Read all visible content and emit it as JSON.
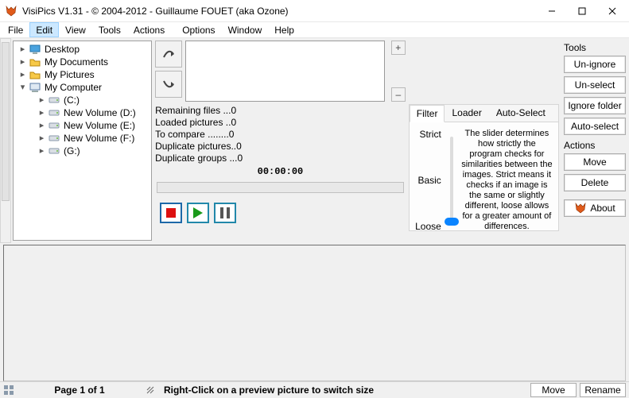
{
  "title": "VisiPics V1.31 - © 2004-2012 - Guillaume FOUET (aka Ozone)",
  "menu": {
    "file": "File",
    "edit": "Edit",
    "view": "View",
    "tools": "Tools",
    "actions": "Actions",
    "options": "Options",
    "window": "Window",
    "help": "Help"
  },
  "tree": {
    "desktop": "Desktop",
    "mydocs": "My Documents",
    "mypics": "My Pictures",
    "mycomp": "My Computer",
    "drives": {
      "c": "(C:)",
      "d": "New Volume (D:)",
      "e": "New Volume (E:)",
      "f": "New Volume (F:)",
      "g": "(G:)"
    }
  },
  "stats": {
    "remaining": "Remaining files ...0",
    "loaded": "Loaded pictures ..0",
    "compare": "To compare ........0",
    "duppics": "Duplicate pictures..0",
    "dupgroups": "Duplicate groups ...0",
    "timer": "00:00:00"
  },
  "tabs": {
    "filter": "Filter",
    "loader": "Loader",
    "autoselect": "Auto-Select"
  },
  "slider": {
    "strict": "Strict",
    "basic": "Basic",
    "loose": "Loose"
  },
  "help": "The slider determines how strictly the program checks for similarities between the images. Strict means it checks if an image is the same or slightly different, loose allows for a greater amount of differences.",
  "tools": {
    "header": "Tools",
    "unignore": "Un-ignore",
    "unselect": "Un-select",
    "ignorefolder": "Ignore folder",
    "autoselect": "Auto-select"
  },
  "actions": {
    "header": "Actions",
    "move": "Move",
    "delete": "Delete",
    "about": "About"
  },
  "status": {
    "page": "Page 1 of 1",
    "hint": "Right-Click on a preview picture to switch size",
    "move": "Move",
    "rename": "Rename"
  },
  "plus": "+",
  "minus": "–"
}
